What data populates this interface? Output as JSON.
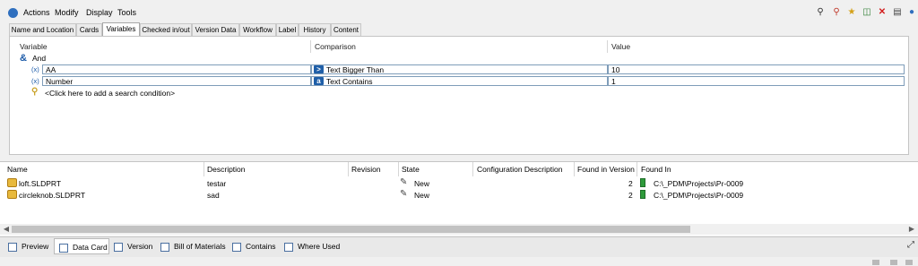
{
  "menubar": {
    "items": [
      "Actions",
      "Modify",
      "Display",
      "Tools"
    ]
  },
  "toolbar": {
    "icons": [
      "find-user-icon",
      "remove-user-icon",
      "favorite-search-icon",
      "export-icon",
      "clear-icon",
      "properties-icon",
      "user-icon"
    ]
  },
  "tabs": [
    "Name and Location",
    "Cards",
    "Variables",
    "Checked in/out",
    "Version Data",
    "Workflow",
    "Label",
    "History",
    "Content"
  ],
  "active_tab": "Variables",
  "variables": {
    "headers": {
      "variable": "Variable",
      "comparison": "Comparison",
      "value": "Value"
    },
    "operator": "And",
    "conditions": [
      {
        "glyph": "(x)",
        "variable": "AA",
        "comparison": "Text Bigger Than",
        "comparison_icon": ">",
        "value": "10"
      },
      {
        "glyph": "(x)",
        "variable": "Number",
        "comparison": "Text Contains",
        "comparison_icon": "a",
        "value": "1"
      }
    ],
    "add_condition": "<Click here to add a search condition>"
  },
  "results": {
    "headers": [
      "Name",
      "Description",
      "Revision",
      "State",
      "Configuration Description",
      "Found in Version",
      "Found In"
    ],
    "rows": [
      {
        "name": "loft.SLDPRT",
        "description": "testar",
        "revision": "",
        "state": "New",
        "config": "",
        "version": "2",
        "found_in": "C:\\_PDM\\Projects\\Pr-0009"
      },
      {
        "name": "circleknob.SLDPRT",
        "description": "sad",
        "revision": "",
        "state": "New",
        "config": "",
        "version": "2",
        "found_in": "C:\\_PDM\\Projects\\Pr-0009"
      }
    ]
  },
  "bottom_tabs": [
    "Preview",
    "Data Card",
    "Version",
    "Bill of Materials",
    "Contains",
    "Where Used"
  ],
  "active_bottom_tab": "Data Card",
  "colors": {
    "accent": "#1b5aa8",
    "comparison_gt": "#1f5fa8",
    "comparison_contains": "#1f5fa8",
    "found_in_icon": "#2e9b3b",
    "clear_icon": "#d21c1c"
  }
}
